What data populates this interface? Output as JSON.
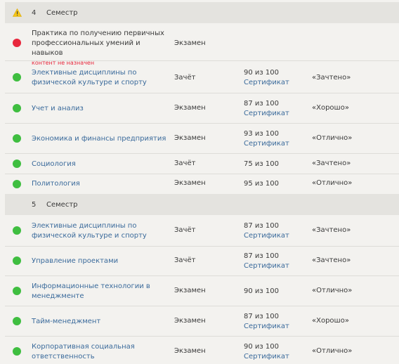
{
  "semesters": [
    {
      "number": "4",
      "label": "Семестр",
      "courses": [
        {
          "name": "Практика по получению первичных профессиональных умений и навыков",
          "status": "red",
          "note": "контент не назначен",
          "type": "Экзамен",
          "score": "",
          "cert": "",
          "grade": "",
          "link": false
        },
        {
          "name": "Элективные дисциплины по физической культуре и спорту",
          "status": "green",
          "note": "",
          "type": "Зачёт",
          "score": "90 из 100",
          "cert": "Сертификат",
          "grade": "«Зачтено»",
          "link": true
        },
        {
          "name": "Учет и анализ",
          "status": "green",
          "note": "",
          "type": "Экзамен",
          "score": "87 из 100",
          "cert": "Сертификат",
          "grade": "«Хорошо»",
          "link": true
        },
        {
          "name": "Экономика и финансы предприятия",
          "status": "green",
          "note": "",
          "type": "Экзамен",
          "score": "93 из 100",
          "cert": "Сертификат",
          "grade": "«Отлично»",
          "link": true
        },
        {
          "name": "Социология",
          "status": "green",
          "note": "",
          "type": "Зачёт",
          "score": "75 из 100",
          "cert": "",
          "grade": "«Зачтено»",
          "link": true
        },
        {
          "name": "Политология",
          "status": "green",
          "note": "",
          "type": "Экзамен",
          "score": "95 из 100",
          "cert": "",
          "grade": "«Отлично»",
          "link": true
        }
      ]
    },
    {
      "number": "5",
      "label": "Семестр",
      "courses": [
        {
          "name": "Элективные дисциплины по физической культуре и спорту",
          "status": "green",
          "note": "",
          "type": "Зачёт",
          "score": "87 из 100",
          "cert": "Сертификат",
          "grade": "«Зачтено»",
          "link": true
        },
        {
          "name": "Управление проектами",
          "status": "green",
          "note": "",
          "type": "Зачёт",
          "score": "87 из 100",
          "cert": "Сертификат",
          "grade": "«Зачтено»",
          "link": true
        },
        {
          "name": "Информационные технологии в менеджменте",
          "status": "green",
          "note": "",
          "type": "Экзамен",
          "score": "90 из 100",
          "cert": "",
          "grade": "«Отлично»",
          "link": true
        },
        {
          "name": "Тайм-менеджмент",
          "status": "green",
          "note": "",
          "type": "Экзамен",
          "score": "87 из 100",
          "cert": "Сертификат",
          "grade": "«Хорошо»",
          "link": true
        },
        {
          "name": "Корпоративная социальная ответственность",
          "status": "green",
          "note": "",
          "type": "Экзамен",
          "score": "90 из 100",
          "cert": "Сертификат",
          "grade": "«Отлично»",
          "link": true
        }
      ]
    }
  ],
  "colors": {
    "green": "#3fbe40",
    "red": "#e8283d",
    "link": "#3a6a9b",
    "warning": "#f5c518"
  },
  "icons": {
    "warning": "warning-triangle-icon",
    "status": "status-dot-icon"
  }
}
